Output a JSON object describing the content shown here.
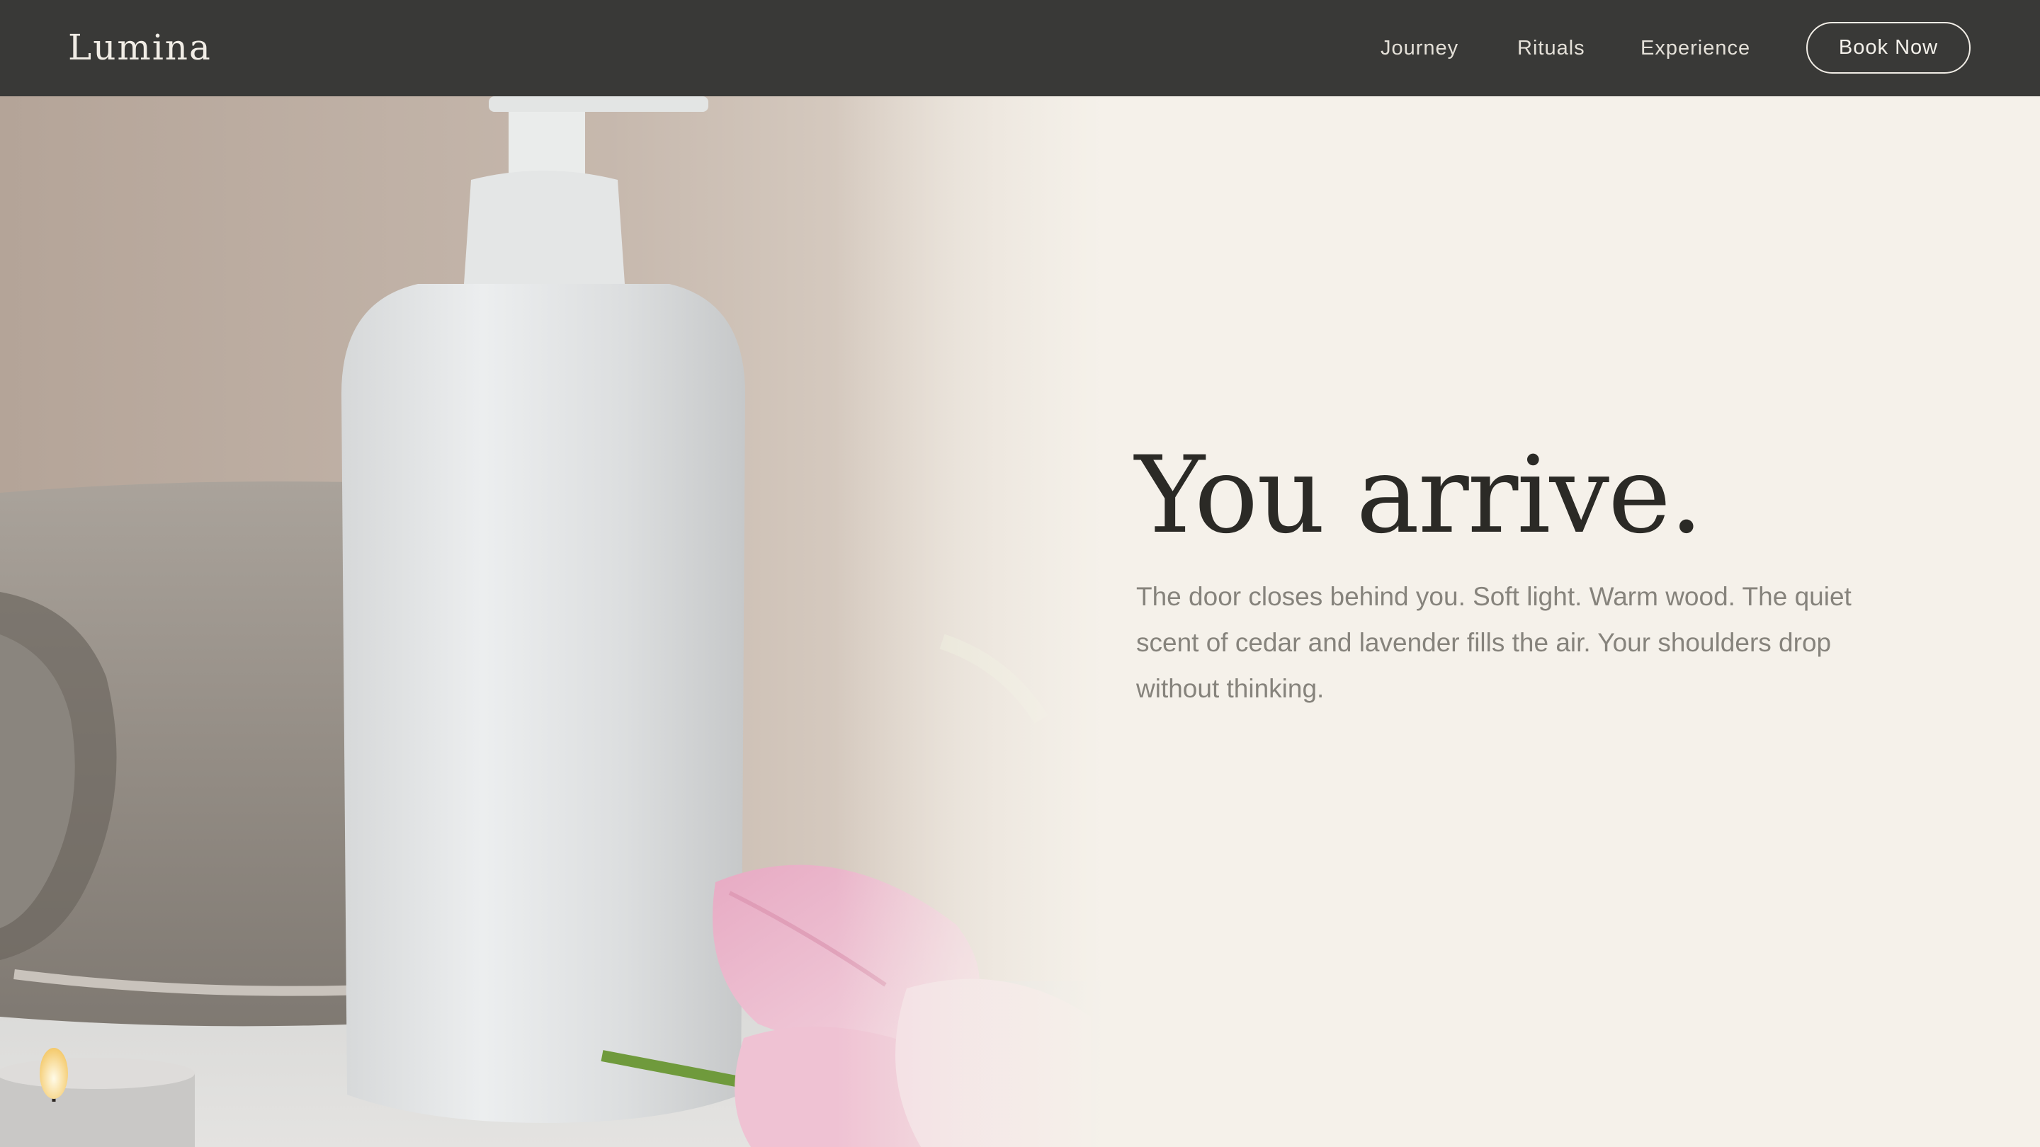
{
  "header": {
    "logo": "Lumina",
    "nav": [
      {
        "label": "Journey"
      },
      {
        "label": "Rituals"
      },
      {
        "label": "Experience"
      }
    ],
    "cta_label": "Book Now"
  },
  "hero": {
    "title": "You arrive.",
    "body": "The door closes behind you. Soft light. Warm wood. The quiet scent of cedar and lavender fills the air. Your shoulders drop without thinking."
  },
  "colors": {
    "header_bg": "#393937",
    "page_bg": "#f5f1ea",
    "title_text": "#2b2a26",
    "body_text": "#86837c"
  }
}
